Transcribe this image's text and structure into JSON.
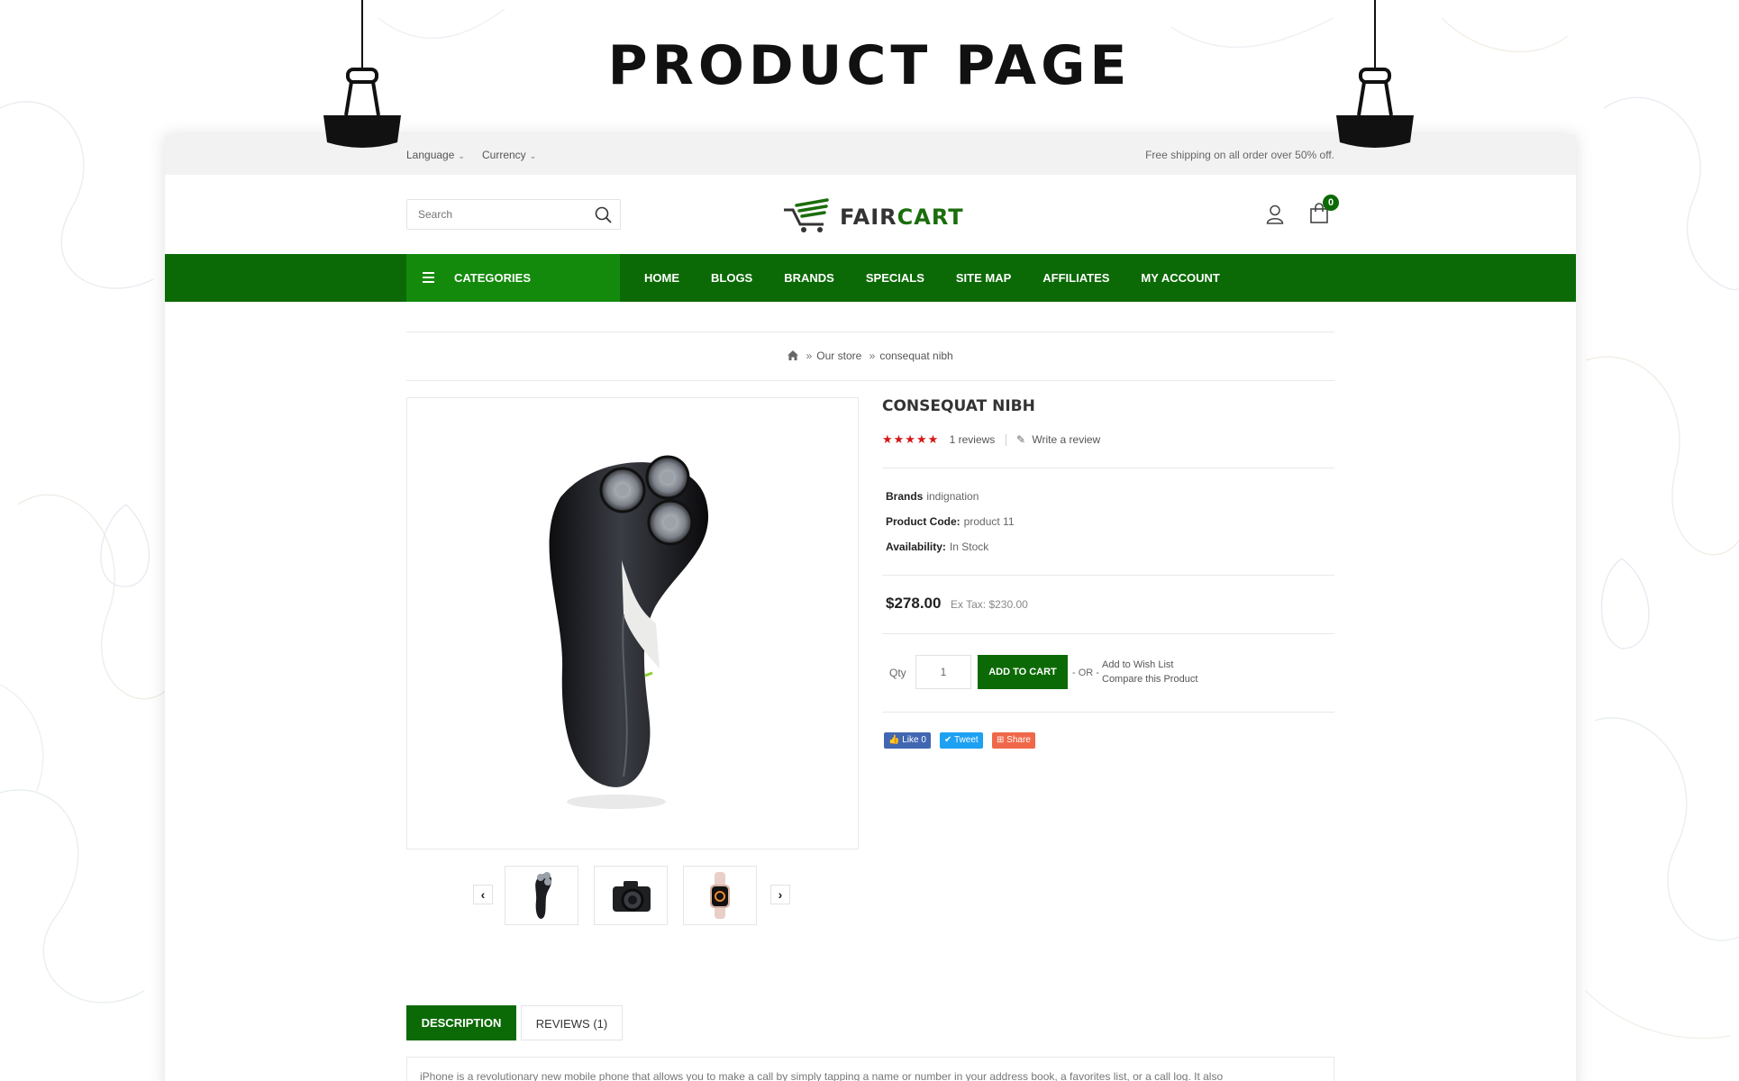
{
  "hero": {
    "title": "PRODUCT PAGE"
  },
  "topbar": {
    "language": "Language",
    "currency": "Currency",
    "shipping": "Free shipping on all order over 50% off."
  },
  "header": {
    "search_placeholder": "Search",
    "logo_part1": "FAIR",
    "logo_part2": "CART",
    "cart_count": "0"
  },
  "nav": {
    "categories": "CATEGORIES",
    "items": [
      "HOME",
      "BLOGS",
      "BRANDS",
      "SPECIALS",
      "SITE MAP",
      "AFFILIATES",
      "MY ACCOUNT"
    ]
  },
  "breadcrumb": {
    "store": "Our store",
    "current": "consequat nibh"
  },
  "product": {
    "name": "CONSEQUAT NIBH",
    "stars": "★★★★★",
    "rating": 5,
    "reviews": "1 reviews",
    "write_review": "Write a review",
    "brand_label": "Brands",
    "brand_value": "indignation",
    "code_label": "Product Code:",
    "code_value": "product 11",
    "availability_label": "Availability:",
    "availability_value": "In Stock",
    "price": "$278.00",
    "ex_tax": "Ex Tax: $230.00",
    "qty_label": "Qty",
    "qty_value": "1",
    "add_to_cart": "ADD TO CART",
    "or": "- OR -",
    "wishlist": "Add to Wish List",
    "compare": "Compare this Product"
  },
  "social": {
    "like": "Like 0",
    "tweet": "Tweet",
    "share": "Share"
  },
  "tabs": {
    "description": "DESCRIPTION",
    "reviews": "REVIEWS (1)"
  },
  "description": {
    "text": "iPhone is a revolutionary new mobile phone that allows you to make a call by simply tapping a name or number in your address book, a favorites list, or a call log. It also"
  },
  "colors": {
    "primary": "#0c6a06",
    "categories_bg": "#148a0c",
    "stars": "#d41616"
  }
}
